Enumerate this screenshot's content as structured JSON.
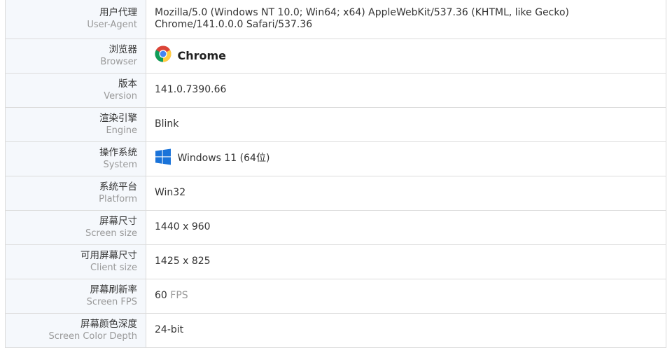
{
  "rows": [
    {
      "label_zh": "用户代理",
      "label_en": "User-Agent",
      "value": "Mozilla/5.0 (Windows NT 10.0; Win64; x64) AppleWebKit/537.36 (KHTML, like Gecko) Chrome/141.0.0.0 Safari/537.36"
    },
    {
      "label_zh": "浏览器",
      "label_en": "Browser",
      "value": "Chrome",
      "icon": "chrome-icon"
    },
    {
      "label_zh": "版本",
      "label_en": "Version",
      "value": "141.0.7390.66"
    },
    {
      "label_zh": "渲染引擎",
      "label_en": "Engine",
      "value": "Blink"
    },
    {
      "label_zh": "操作系统",
      "label_en": "System",
      "value": "Windows 11 (64位)",
      "icon": "windows-icon"
    },
    {
      "label_zh": "系统平台",
      "label_en": "Platform",
      "value": "Win32"
    },
    {
      "label_zh": "屏幕尺寸",
      "label_en": "Screen size",
      "value": "1440 x 960"
    },
    {
      "label_zh": "可用屏幕尺寸",
      "label_en": "Client size",
      "value": "1425 x 825"
    },
    {
      "label_zh": "屏幕刷新率",
      "label_en": "Screen FPS",
      "value": "60",
      "unit": "FPS"
    },
    {
      "label_zh": "屏幕颜色深度",
      "label_en": "Screen Color Depth",
      "value": "24-bit"
    }
  ],
  "colors": {
    "label_bg": "#f5f8fc",
    "border": "#dcdcdc",
    "windows_blue": "#1a73d9"
  }
}
